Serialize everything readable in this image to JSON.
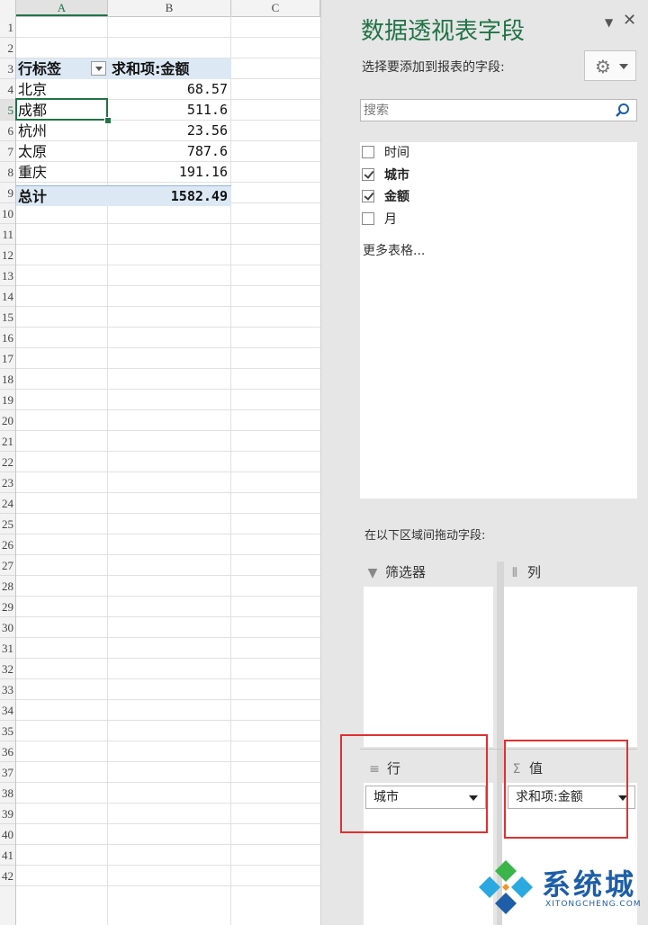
{
  "sheet": {
    "columns": [
      "A",
      "B",
      "C"
    ],
    "row_numbers": [
      "1",
      "2",
      "3",
      "4",
      "5",
      "6",
      "7",
      "8",
      "9",
      "10",
      "11",
      "12",
      "13",
      "14",
      "15",
      "16",
      "17",
      "18",
      "19",
      "20",
      "21",
      "22",
      "23",
      "24",
      "25",
      "26",
      "27",
      "28",
      "29",
      "30",
      "31",
      "32",
      "33",
      "34",
      "35",
      "36",
      "37",
      "38",
      "39",
      "40",
      "41",
      "42"
    ],
    "pivot": {
      "header_label": "行标签",
      "header_value": "求和项:金额",
      "rows": [
        {
          "label": "北京",
          "value": "68.57"
        },
        {
          "label": "成都",
          "value": "511.6"
        },
        {
          "label": "杭州",
          "value": "23.56"
        },
        {
          "label": "太原",
          "value": "787.6"
        },
        {
          "label": "重庆",
          "value": "191.16"
        }
      ],
      "total_label": "总计",
      "total_value": "1582.49"
    }
  },
  "pane": {
    "title": "数据透视表字段",
    "choose_label": "选择要添加到报表的字段:",
    "search_placeholder": "搜索",
    "fields": [
      {
        "label": "时间",
        "checked": false
      },
      {
        "label": "城市",
        "checked": true
      },
      {
        "label": "金额",
        "checked": true
      },
      {
        "label": "月",
        "checked": false
      }
    ],
    "more_tables": "更多表格...",
    "drag_label": "在以下区域间拖动字段:",
    "areas": {
      "filters": {
        "label": "筛选器",
        "icon": "filter-icon"
      },
      "columns": {
        "label": "列",
        "icon": "columns-icon"
      },
      "rows": {
        "label": "行",
        "icon": "rows-icon",
        "item": "城市"
      },
      "values": {
        "label": "值",
        "icon": "sigma-icon",
        "item": "求和项:金额"
      }
    }
  },
  "watermark": {
    "text": "系统城",
    "sub": "XITONGCHENG.COM"
  },
  "colors": {
    "accent": "#217346",
    "pivot_header": "#dce9f5",
    "highlight_box": "#e03030",
    "watermark": "#1e5ea8"
  }
}
